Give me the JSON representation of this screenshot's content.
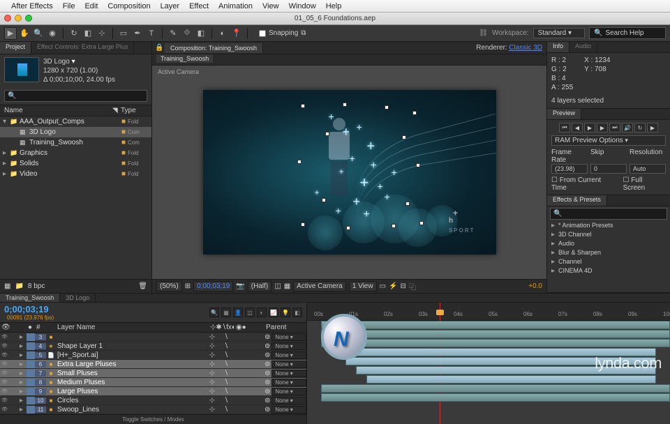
{
  "menubar": [
    "After Effects",
    "File",
    "Edit",
    "Composition",
    "Layer",
    "Effect",
    "Animation",
    "View",
    "Window",
    "Help"
  ],
  "window_title": "01_05_6 Foundations.aep",
  "snapping": "Snapping",
  "workspace": {
    "label": "Workspace:",
    "value": "Standard"
  },
  "search_help": "Search Help",
  "project": {
    "tab": "Project",
    "tab2": "Effect Controls: Extra Large Plus",
    "name": "3D Logo",
    "dims": "1280 x 720 (1.00)",
    "dur": "Δ 0;00;10;00, 24.00 fps",
    "name_col": "Name",
    "type_col": "Type",
    "items": [
      {
        "twist": "▾",
        "icon": "📁",
        "name": "AAA_Output_Comps",
        "type": "Fold",
        "sel": false,
        "child": false
      },
      {
        "twist": "",
        "icon": "▦",
        "name": "3D Logo",
        "type": "Com",
        "sel": true,
        "child": true
      },
      {
        "twist": "",
        "icon": "▦",
        "name": "Training_Swoosh",
        "type": "Com",
        "sel": false,
        "child": true
      },
      {
        "twist": "▸",
        "icon": "📁",
        "name": "Graphics",
        "type": "Fold",
        "sel": false,
        "child": false
      },
      {
        "twist": "▸",
        "icon": "📁",
        "name": "Solids",
        "type": "Fold",
        "sel": false,
        "child": false
      },
      {
        "twist": "▸",
        "icon": "📁",
        "name": "Video",
        "type": "Fold",
        "sel": false,
        "child": false
      }
    ],
    "bpc": "8 bpc"
  },
  "comp": {
    "panel_label": "Composition: Training_Swoosh",
    "renderer_label": "Renderer:",
    "renderer_value": "Classic 3D",
    "sub": "Training_Swoosh",
    "view_label": "Active Camera",
    "logo": "h",
    "logo_plus": "+",
    "logo_sport": "SPORT",
    "footer": {
      "zoom": "(50%)",
      "time": "0;00;03;19",
      "res": "(Half)",
      "cam": "Active Camera",
      "view": "1 View",
      "exp": "+0.0"
    }
  },
  "info": {
    "tab": "Info",
    "tab2": "Audio",
    "r": "R : 2",
    "g": "G : 2",
    "b": "B : 4",
    "a": "A : 255",
    "x": "X : 1234",
    "y": "Y : 708",
    "sel": "4 layers selected"
  },
  "preview": {
    "tab": "Preview",
    "ram": "RAM Preview Options",
    "fr_label": "Frame Rate",
    "skip_label": "Skip",
    "res_label": "Resolution",
    "fr": "(23.98)",
    "skip": "0",
    "res": "Auto",
    "chk1": "From Current Time",
    "chk2": "Full Screen"
  },
  "effects": {
    "tab": "Effects & Presets",
    "items": [
      "Animation Presets",
      "3D Channel",
      "Audio",
      "Blur & Sharpen",
      "Channel",
      "CINEMA 4D"
    ]
  },
  "timeline": {
    "tab1": "Training_Swoosh",
    "tab2": "3D Logo",
    "time": "0;00;03;19",
    "frame": "00091 (23.976 fps)",
    "col_layer": "Layer Name",
    "col_parent": "Parent",
    "toggle": "Toggle Switches / Modes",
    "ruler": [
      "00s",
      "01s",
      "02s",
      "03s",
      "04s",
      "05s",
      "06s",
      "07s",
      "08s",
      "09s",
      "10s"
    ],
    "layers": [
      {
        "num": "3",
        "name": "",
        "icon": "■",
        "sel": false,
        "parent": "None",
        "color": "#5a7aa0"
      },
      {
        "num": "4",
        "name": "Shape Layer 1",
        "icon": "★",
        "sel": false,
        "parent": "None",
        "color": "#5a7aa0"
      },
      {
        "num": "5",
        "name": "[H+_Sport.ai]",
        "icon": "📄",
        "sel": false,
        "parent": "None",
        "color": "#5a7aa0"
      },
      {
        "num": "6",
        "name": "Extra Large Pluses",
        "icon": "■",
        "sel": true,
        "parent": "None",
        "color": "#5a7aa0"
      },
      {
        "num": "7",
        "name": "Small Pluses",
        "icon": "■",
        "sel": true,
        "parent": "None",
        "color": "#5a7aa0"
      },
      {
        "num": "8",
        "name": "Medium Pluses",
        "icon": "■",
        "sel": true,
        "parent": "None",
        "color": "#5a7aa0"
      },
      {
        "num": "9",
        "name": "Large Pluses",
        "icon": "■",
        "sel": true,
        "parent": "None",
        "color": "#5a7aa0"
      },
      {
        "num": "10",
        "name": "Circles",
        "icon": "■",
        "sel": false,
        "parent": "None",
        "color": "#5a7aa0"
      },
      {
        "num": "11",
        "name": "Swoop_Lines",
        "icon": "■",
        "sel": false,
        "parent": "None",
        "color": "#5a7aa0"
      }
    ]
  },
  "watermark": "lynda.com"
}
